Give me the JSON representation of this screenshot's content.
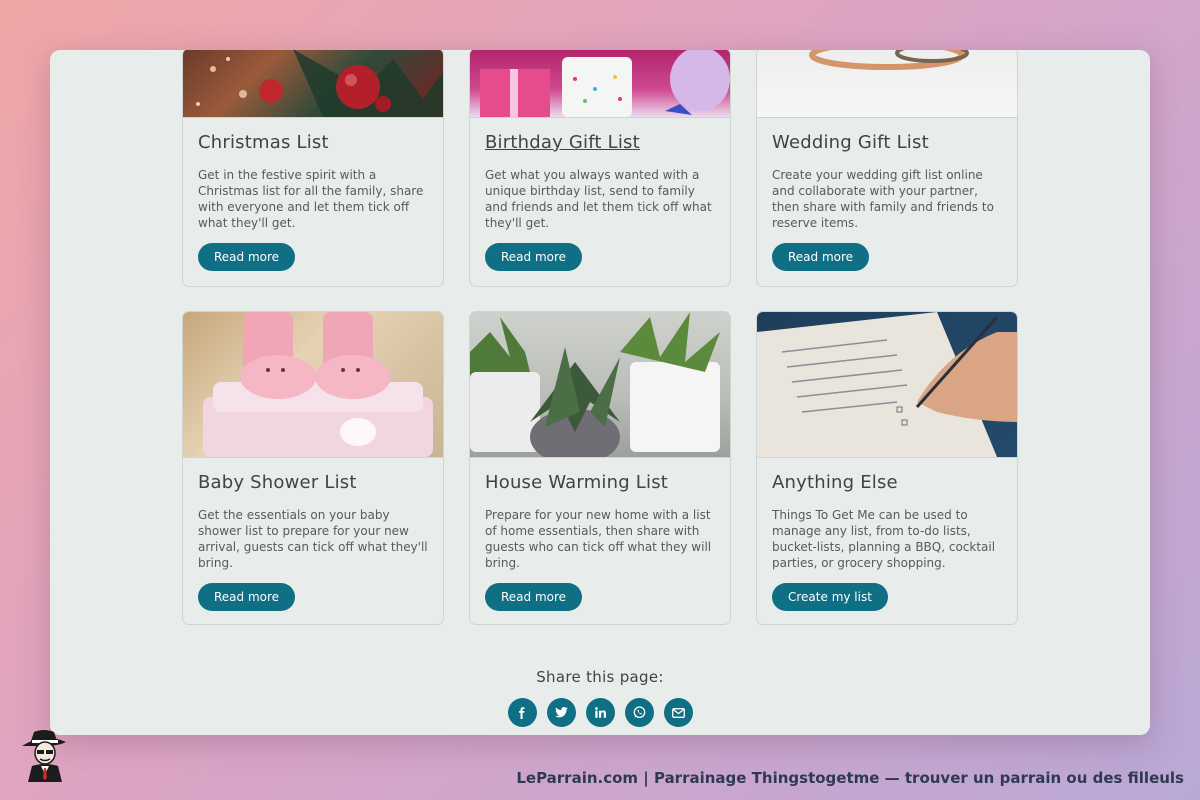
{
  "cards": [
    {
      "title": "Christmas List",
      "description": "Get in the festive spirit with a Christmas list for all the family, share with everyone and let them tick off what they'll get.",
      "button": "Read more",
      "image": "christmas-ornaments-image"
    },
    {
      "title": "Birthday Gift List",
      "description": "Get what you always wanted with a unique birthday list, send to family and friends and let them tick off what they'll get.",
      "button": "Read more",
      "image": "birthday-cake-image"
    },
    {
      "title": "Wedding Gift List",
      "description": "Create your wedding gift list online and collaborate with your partner, then share with family and friends to reserve items.",
      "button": "Read more",
      "image": "wedding-rings-image"
    },
    {
      "title": "Baby Shower List",
      "description": "Get the essentials on your baby shower list to prepare for your new arrival, guests can tick off what they'll bring.",
      "button": "Read more",
      "image": "baby-shoes-image"
    },
    {
      "title": "House Warming List",
      "description": "Prepare for your new home with a list of home essentials, then share with guests who can tick off what they will bring.",
      "button": "Read more",
      "image": "house-plants-image"
    },
    {
      "title": "Anything Else",
      "description": "Things To Get Me can be used to manage any list, from to-do lists, bucket-lists, planning a BBQ, cocktail parties, or grocery shopping.",
      "button": "Create my list",
      "image": "writing-list-image"
    }
  ],
  "share": {
    "title": "Share this page:",
    "icons": [
      "facebook-icon",
      "twitter-icon",
      "linkedin-icon",
      "whatsapp-icon",
      "email-icon"
    ]
  },
  "footer": {
    "text": "LeParrain.com | Parrainage Thingstogetme — trouver un parrain ou des filleuls"
  },
  "colors": {
    "accent": "#0f6f84",
    "card_background": "#e8ecea",
    "text_dark": "#3f4447"
  }
}
